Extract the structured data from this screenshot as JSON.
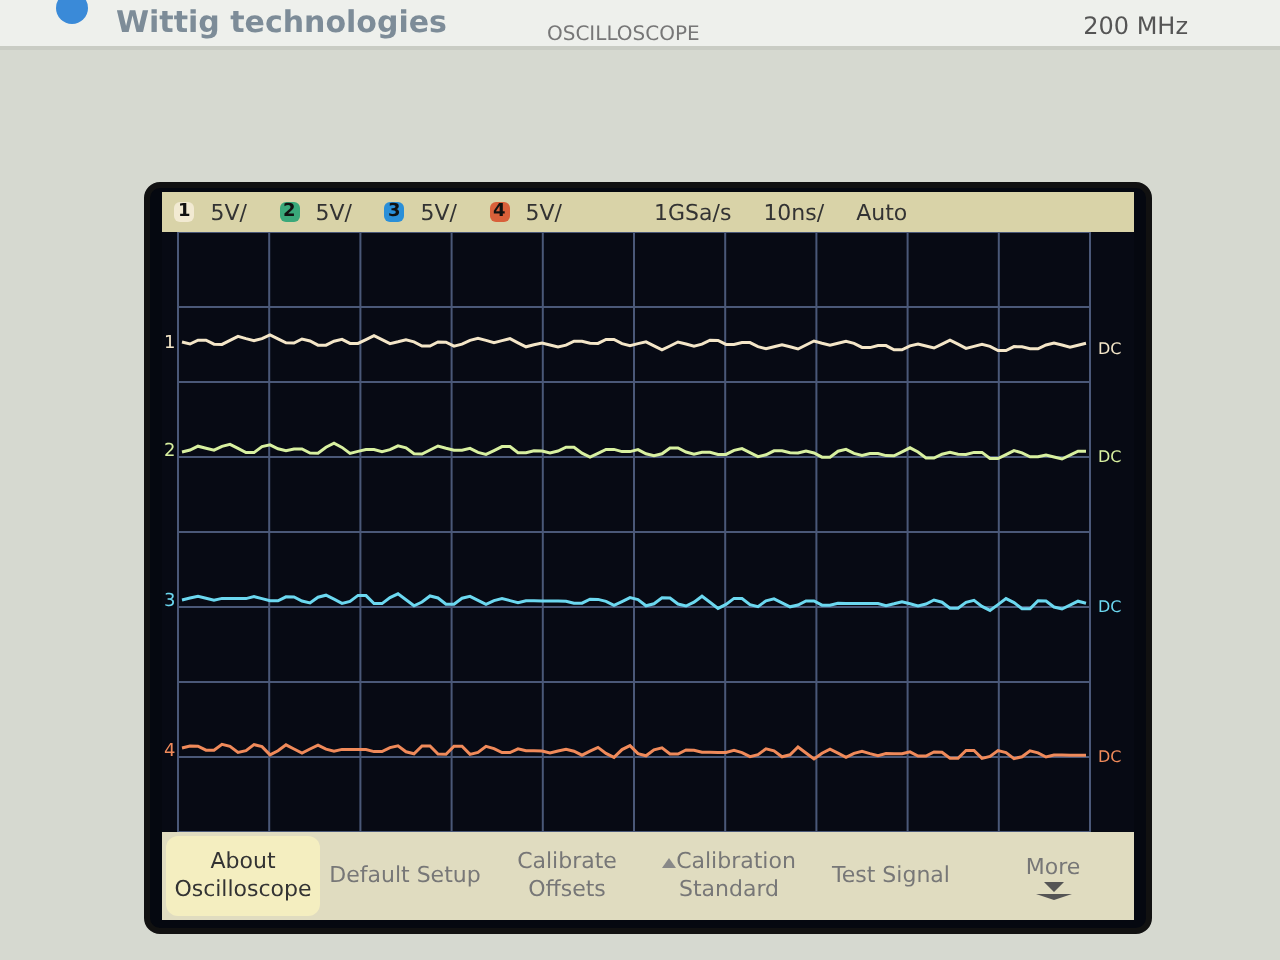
{
  "header": {
    "brand": "Wittig technologies",
    "product": "OSCILLOSCOPE",
    "bandwidth": "200 MHz"
  },
  "status_bar": {
    "channels": [
      {
        "number": "1",
        "scale": "5V/",
        "color": "#f2ead2"
      },
      {
        "number": "2",
        "scale": "5V/",
        "color": "#3aa87a"
      },
      {
        "number": "3",
        "scale": "5V/",
        "color": "#2a8fd8"
      },
      {
        "number": "4",
        "scale": "5V/",
        "color": "#d8603a"
      }
    ],
    "sample_rate": "1GSa/s",
    "timebase": "10ns/",
    "trigger_mode": "Auto"
  },
  "plot": {
    "traces": [
      {
        "marker": "1",
        "coupling": "DC",
        "color": "#f4e6c8"
      },
      {
        "marker": "2",
        "coupling": "DC",
        "color": "#d8f0a0"
      },
      {
        "marker": "3",
        "coupling": "DC",
        "color": "#6cd8f0"
      },
      {
        "marker": "4",
        "coupling": "DC",
        "color": "#f08a5a"
      }
    ]
  },
  "menu": [
    {
      "label": "About Oscilloscope",
      "selected": true,
      "kind": "plain"
    },
    {
      "label": "Default Setup",
      "selected": false,
      "kind": "plain"
    },
    {
      "label": "Calibrate Offsets",
      "selected": false,
      "kind": "plain"
    },
    {
      "label": "Calibration Standard",
      "selected": false,
      "kind": "up"
    },
    {
      "label": "Test Signal",
      "selected": false,
      "kind": "plain"
    },
    {
      "label": "More",
      "selected": false,
      "kind": "down"
    }
  ]
}
